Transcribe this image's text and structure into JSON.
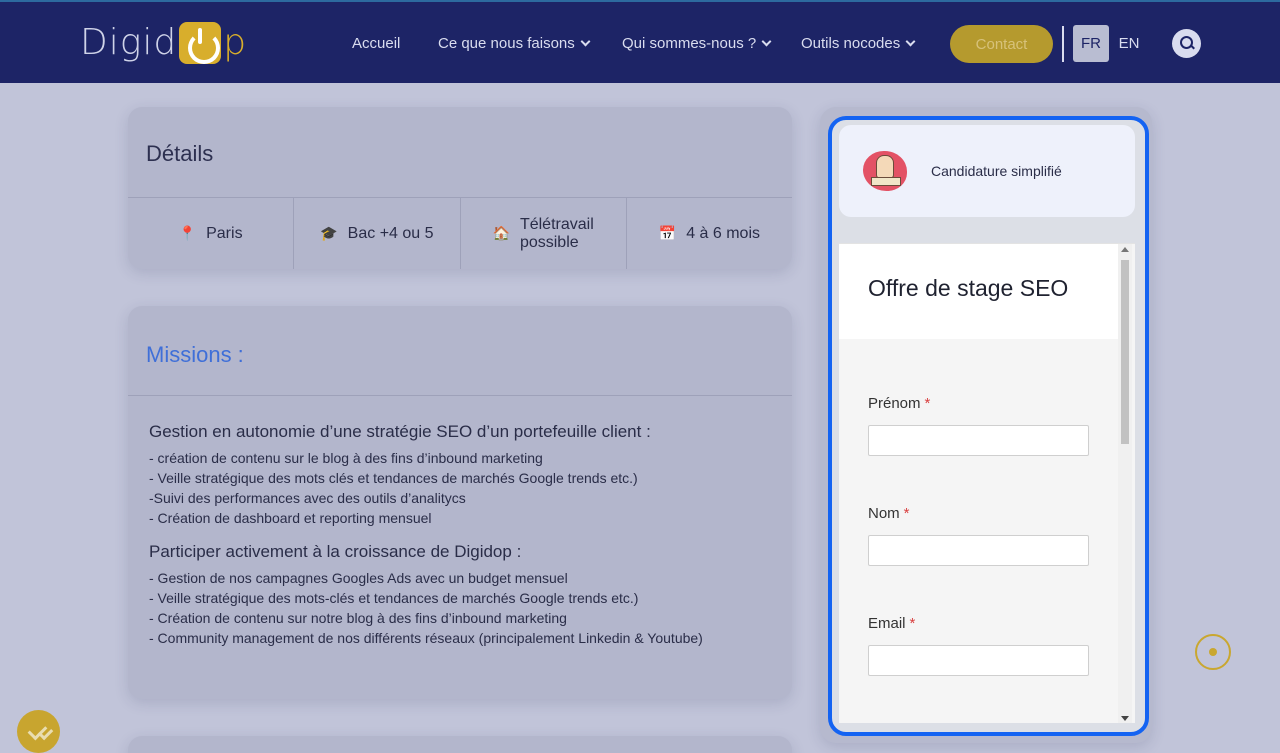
{
  "header": {
    "logo_text_main": "Digid",
    "logo_text_end": "p",
    "nav": [
      {
        "label": "Accueil"
      },
      {
        "label": "Ce que nous faisons"
      },
      {
        "label": "Qui sommes-nous ?"
      },
      {
        "label": "Outils nocodes"
      }
    ],
    "contact_label": "Contact",
    "lang_fr": "FR",
    "lang_en": "EN"
  },
  "details": {
    "title": "Détails",
    "items": [
      {
        "icon": "pin-icon",
        "label": "Paris"
      },
      {
        "icon": "graduation-cap-icon",
        "label": "Bac +4 ou 5"
      },
      {
        "icon": "house-icon",
        "label_line1": "Télétravail",
        "label_line2": "possible"
      },
      {
        "icon": "calendar-icon",
        "label": "4 à 6 mois"
      }
    ]
  },
  "missions": {
    "title": "Missions :",
    "blocks": [
      {
        "heading": "Gestion en autonomie d’une stratégie SEO d’un portefeuille client :",
        "lines": [
          "- création de contenu sur le blog à des fins d’inbound marketing",
          "- Veille stratégique des mots clés et tendances de marchés Google trends etc.)",
          "-Suivi des performances avec des outils d’analitycs",
          "- Création de dashboard et reporting mensuel"
        ]
      },
      {
        "heading": "Participer activement à la croissance de Digidop :",
        "lines": [
          "- Gestion de nos campagnes Googles Ads avec un budget mensuel",
          "- Veille stratégique des mots-clés et tendances de marchés Google trends etc.)",
          "- Création de contenu sur notre blog à des fins d’inbound marketing",
          "- Community management de nos différents réseaux (principalement Linkedin & Youtube)"
        ]
      }
    ]
  },
  "widget": {
    "header_text": "Candidature simplifié",
    "form_title": "Offre de stage SEO",
    "fields": [
      {
        "label": "Prénom",
        "required": "*"
      },
      {
        "label": "Nom",
        "required": "*"
      },
      {
        "label": "Email",
        "required": "*"
      }
    ]
  },
  "colors": {
    "header_bg": "#1d2466",
    "accent_gold": "#d8ae2c",
    "missions_title": "#3f6fd8",
    "widget_border": "#1463f2"
  }
}
